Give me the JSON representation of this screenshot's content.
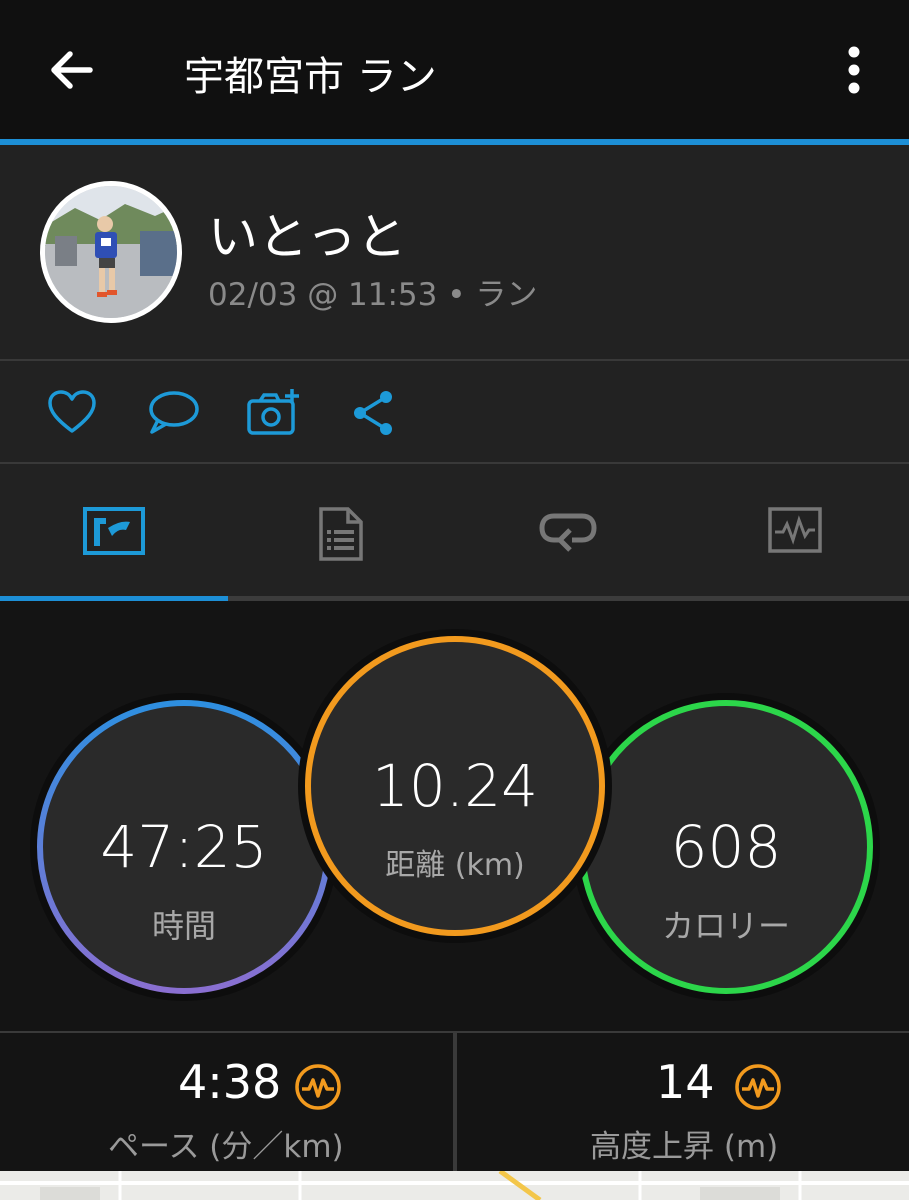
{
  "header": {
    "title": "宇都宮市 ラン",
    "back_icon": "arrow-left-icon",
    "menu_icon": "kebab-menu-icon",
    "accent_color": "#1d8fd6"
  },
  "profile": {
    "name": "いとっと",
    "meta": "02/03 @ 11:53 • ラン"
  },
  "actions": {
    "icons": [
      "heart-icon",
      "comment-icon",
      "add-photo-icon",
      "share-icon"
    ],
    "color": "#1d9ad8"
  },
  "tabs": {
    "items": [
      "overview-tab",
      "details-tab",
      "laps-tab",
      "charts-tab"
    ],
    "selected_index": 0
  },
  "stats": {
    "time": {
      "value": "47:25",
      "label": "時間"
    },
    "distance": {
      "value": "10.24",
      "label": "距離 (km)",
      "ring_color": "#f29a1e"
    },
    "calories": {
      "value": "608",
      "label": "カロリー",
      "ring_color": "#2cd64a"
    },
    "time_ring_colors": [
      "#2e8fe0",
      "#8a6fd1"
    ]
  },
  "summary": {
    "pace": {
      "value": "4:38",
      "label": "ペース (分／km)"
    },
    "elevation": {
      "value": "14",
      "label": "高度上昇 (m)"
    },
    "icon_color": "#f29a1e"
  }
}
